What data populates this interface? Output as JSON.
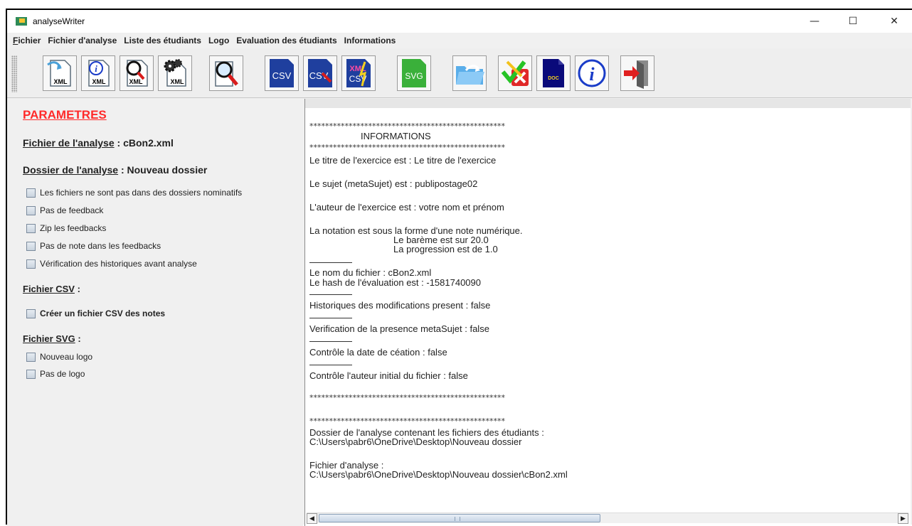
{
  "window": {
    "title": "analyseWriter",
    "controls": {
      "minimize": "—",
      "maximize": "☐",
      "close": "✕"
    }
  },
  "menu": {
    "items": [
      {
        "label": "Fichier",
        "mnemonic": "F"
      },
      {
        "label": "Fichier d'analyse"
      },
      {
        "label": "Liste des étudiants"
      },
      {
        "label": "Logo"
      },
      {
        "label": "Evaluation des étudiants"
      },
      {
        "label": "Informations"
      }
    ]
  },
  "toolbar": {
    "buttons": [
      {
        "icon": "open-xml-icon",
        "label": "XML"
      },
      {
        "icon": "info-xml-icon",
        "label": "XML"
      },
      {
        "icon": "search-xml-icon",
        "label": "XML"
      },
      {
        "icon": "settings-xml-icon",
        "label": "XML"
      },
      {
        "icon": "search-document-icon"
      },
      {
        "icon": "csv-icon",
        "label": "CSV"
      },
      {
        "icon": "csv-edit-icon",
        "label": "CSV"
      },
      {
        "icon": "xml-csv-icon",
        "label": "XML CSV"
      },
      {
        "icon": "svg-icon",
        "label": "SVG"
      },
      {
        "icon": "folder-icon"
      },
      {
        "icon": "check-cancel-icon"
      },
      {
        "icon": "doc-icon",
        "label": "DOC"
      },
      {
        "icon": "info-icon",
        "label": "i"
      },
      {
        "icon": "exit-icon"
      }
    ]
  },
  "left": {
    "title": "PARAMETRES",
    "analysis_file_label": "Fichier de l'analyse",
    "analysis_file_value": " : cBon2.xml",
    "analysis_folder_label": "Dossier de l'analyse",
    "analysis_folder_value": " : Nouveau dossier",
    "options": [
      "Les fichiers ne sont pas dans des dossiers nominatifs",
      "Pas de feedback",
      "Zip les feedbacks",
      "Pas de note dans les feedbacks",
      "Vérification des historiques avant analyse"
    ],
    "csv_label": "Fichier CSV",
    "csv_suffix": " :",
    "csv_option": "Créer un fichier CSV des notes",
    "svg_label": "Fichier SVG",
    "svg_suffix": " :",
    "svg_options": [
      "Nouveau logo",
      "Pas de logo"
    ]
  },
  "text": {
    "stars": "**************************************************",
    "info_title": "INFORMATIONS",
    "title_line": "Le titre de l'exercice est : Le titre de l'exercice",
    "sujet_line": "Le sujet (metaSujet) est : publipostage02",
    "auteur_line": "L'auteur de l'exercice est : votre nom et prénom",
    "notation_line": "La notation est sous la forme d'une note numérique.",
    "bareme_line": "Le barème est sur 20.0",
    "progression_line": "La progression est de 1.0",
    "nom_fichier_line": "Le nom du fichier : cBon2.xml",
    "hash_line": "Le hash de l'évaluation est : -1581740090",
    "historiques_line": "Historiques des modifications present : false",
    "verification_line": "Verification de la presence metaSujet : false",
    "date_line": "Contrôle la date de céation : false",
    "auteur_init_line": "Contrôle l'auteur initial du fichier : false",
    "dossier_label_line": "Dossier de l'analyse contenant les fichiers des étudiants :",
    "dossier_path": "C:\\Users\\pabr6\\OneDrive\\Desktop\\Nouveau dossier",
    "fichier_label_line": "Fichier d'analyse :",
    "fichier_path": "C:\\Users\\pabr6\\OneDrive\\Desktop\\Nouveau dossier\\cBon2.xml"
  },
  "scrollbar": {
    "left_arrow": "◀",
    "right_arrow": "▶"
  },
  "colors": {
    "params_title": "#ff2a2a",
    "csv_blue": "#1f3f9e",
    "svg_green": "#3ab03a"
  }
}
